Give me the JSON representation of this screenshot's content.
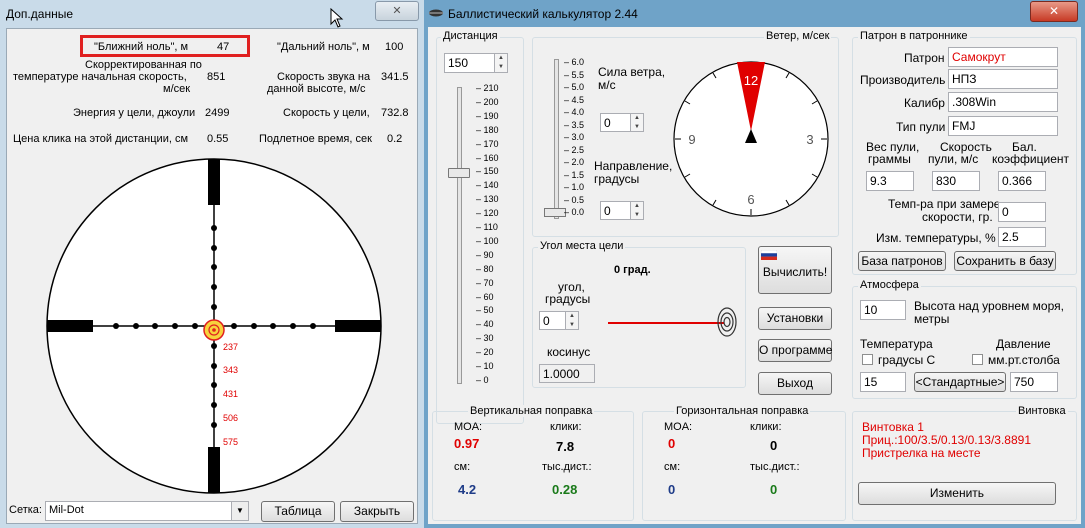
{
  "left_window": {
    "title": "Доп.данные",
    "close_glyph": "✕",
    "stats": {
      "near_zero_label": "\"Ближний ноль\", м",
      "near_zero_value": "47",
      "far_zero_label": "\"Дальний ноль\", м",
      "far_zero_value": "100",
      "corr_velocity_label_1": "Скорректированная по",
      "corr_velocity_label_2": "температуре начальная скорость,",
      "corr_velocity_label_3": "м/сек",
      "corr_velocity_value": "851",
      "sound_speed_label_1": "Скорость звука на",
      "sound_speed_label_2": "данной высоте, м/с",
      "sound_speed_value": "341.5",
      "energy_label": "Энергия у цели, джоули",
      "energy_value": "2499",
      "target_speed_label": "Скорость у цели,",
      "target_speed_value": "732.8",
      "click_price_label": "Цена клика на этой дистанции, см",
      "click_price_value": "0.55",
      "flight_time_label": "Подлетное время, сек",
      "flight_time_value": "0.2"
    },
    "reticle": {
      "range_marks": [
        "237",
        "343",
        "431",
        "506",
        "575"
      ]
    },
    "reticle_select_label": "Сетка:",
    "reticle_select_value": "Mil-Dot",
    "table_button": "Таблица",
    "close_button": "Закрыть"
  },
  "main_window": {
    "title": "Баллистический калькулятор 2.44",
    "distance": {
      "caption": "Дистанция",
      "value": "150",
      "ticks": [
        "210",
        "200",
        "190",
        "180",
        "170",
        "160",
        "150",
        "140",
        "130",
        "120",
        "110",
        "100",
        "90",
        "80",
        "70",
        "60",
        "50",
        "40",
        "30",
        "20",
        "10",
        "0"
      ],
      "slider_value": 150,
      "slider_max": 210
    },
    "wind": {
      "caption": "Ветер, м/сек",
      "ticks": [
        "6.0",
        "5.5",
        "5.0",
        "4.5",
        "4.0",
        "3.5",
        "3.0",
        "2.5",
        "2.0",
        "1.5",
        "1.0",
        "0.5",
        "0.0"
      ],
      "strength_label_1": "Сила ветра,",
      "strength_label_2": "м/с",
      "strength_value": "0",
      "direction_label_1": "Направление,",
      "direction_label_2": "градусы",
      "direction_value": "0",
      "clock_12": "12",
      "clock_3": "3",
      "clock_6": "6",
      "clock_9": "9"
    },
    "angle": {
      "caption": "Угол места цели",
      "degrees_display": "0 град.",
      "angle_label_1": "угол,",
      "angle_label_2": "градусы",
      "angle_value": "0",
      "cosine_label": "косинус",
      "cosine_value": "1.0000"
    },
    "buttons": {
      "calculate": "Вычислить!",
      "settings": "Установки",
      "about": "О программе",
      "exit": "Выход"
    },
    "vertical": {
      "caption": "Вертикальная поправка",
      "moa_label": "MOA:",
      "moa_value": "0.97",
      "clicks_label": "клики:",
      "clicks_value": "7.8",
      "cm_label": "см:",
      "cm_value": "4.2",
      "mil_label": "тыс.дист.:",
      "mil_value": "0.28"
    },
    "horizontal": {
      "caption": "Горизонтальная поправка",
      "moa_label": "MOA:",
      "moa_value": "0",
      "clicks_label": "клики:",
      "clicks_value": "0",
      "cm_label": "см:",
      "cm_value": "0",
      "mil_label": "тыс.дист.:",
      "mil_value": "0"
    },
    "cartridge": {
      "caption": "Патрон в патроннике",
      "cartridge_label": "Патрон",
      "cartridge_value": "Самокрут",
      "maker_label": "Производитель",
      "maker_value": "НПЗ",
      "caliber_label": "Калибр",
      "caliber_value": ".308Win",
      "bullet_type_label": "Тип пули",
      "bullet_type_value": "FMJ",
      "weight_label_1": "Вес пули,",
      "weight_label_2": "граммы",
      "weight_value": "9.3",
      "velocity_label_1": "Скорость",
      "velocity_label_2": "пули, м/с",
      "velocity_value": "830",
      "bc_label_1": "Бал.",
      "bc_label_2": "коэффициент",
      "bc_value": "0.366",
      "temp_measure_label_1": "Темп-ра при замере",
      "temp_measure_label_2": "скорости, гр.",
      "temp_measure_value": "0",
      "temp_change_label": "Изм. температуры, %",
      "temp_change_value": "2.5",
      "db_button": "База патронов",
      "save_button": "Сохранить в базу"
    },
    "atmosphere": {
      "caption": "Атмосфера",
      "altitude_value": "10",
      "altitude_label_1": "Высота над уровнем моря,",
      "altitude_label_2": "метры",
      "temperature_label": "Температура",
      "pressure_label": "Давление",
      "celsius_label": "градусы С",
      "mmhg_label": "мм.рт.столба",
      "temperature_value": "15",
      "standard_button": "<Стандартные>",
      "pressure_value": "750"
    },
    "rifle": {
      "caption": "Винтовка",
      "line1": "Винтовка 1",
      "line2": "Приц.:100/3.5/0.13/0.13/3.8891",
      "line3": "Пристрелка на месте",
      "change_button": "Изменить"
    }
  },
  "colors": {
    "accent_red": "#e00000",
    "value_blue": "#1f3c88",
    "value_green": "#1a7a1a",
    "highlight": "#e02020"
  }
}
